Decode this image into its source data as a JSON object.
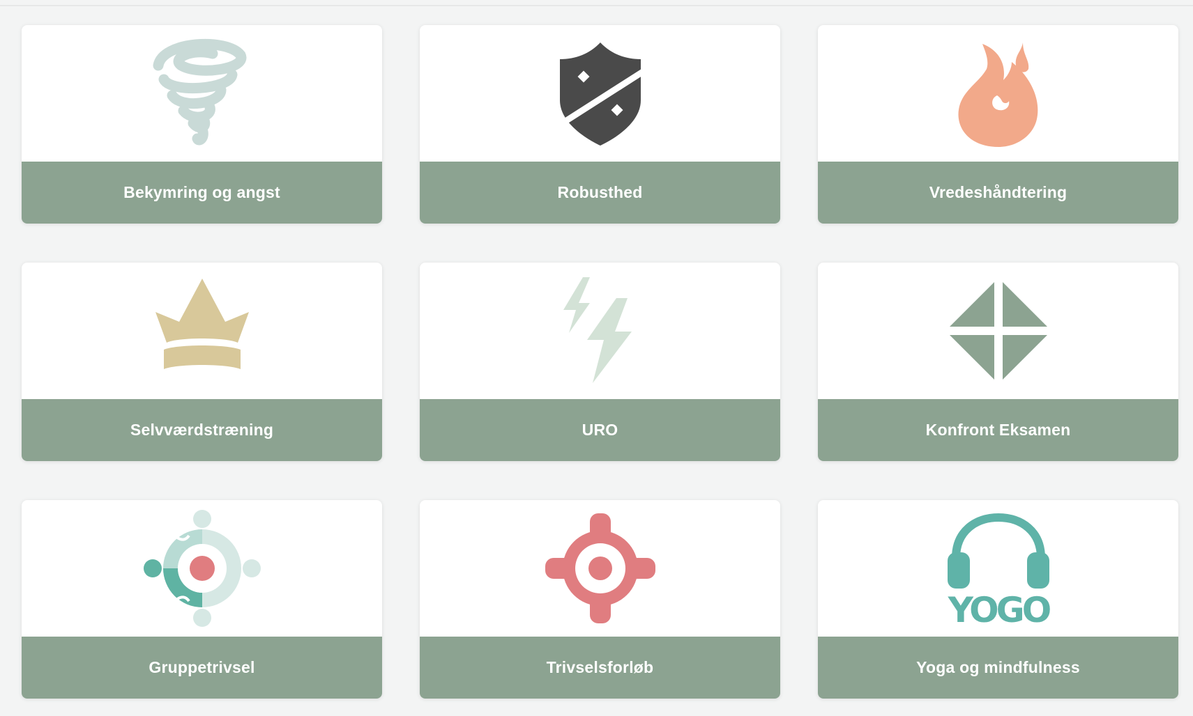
{
  "cards": [
    {
      "label": "Bekymring og angst",
      "icon": "tornado-icon",
      "color": "#c9dad7"
    },
    {
      "label": "Robusthed",
      "icon": "shield-icon",
      "color": "#4a4a4a"
    },
    {
      "label": "Vredeshåndtering",
      "icon": "flame-icon",
      "color": "#f2a98a"
    },
    {
      "label": "Selvværdstræning",
      "icon": "crown-icon",
      "color": "#d8c89a"
    },
    {
      "label": "URO",
      "icon": "lightning-icon",
      "color": "#d3e2d6"
    },
    {
      "label": "Konfront Eksamen",
      "icon": "four-triangles-icon",
      "color": "#8ca391"
    },
    {
      "label": "Gruppetrivsel",
      "icon": "group-circle-icon",
      "color": "#5fb3a3"
    },
    {
      "label": "Trivselsforløb",
      "icon": "target-icon",
      "color": "#e07d80"
    },
    {
      "label": "Yoga og mindfulness",
      "icon": "yogo-headphones-icon",
      "color": "#5fb3a8",
      "logo_text": "YOGO"
    }
  ],
  "colors": {
    "background": "#f3f4f4",
    "card_label_bg": "#8ca391",
    "card_label_text": "#ffffff"
  }
}
